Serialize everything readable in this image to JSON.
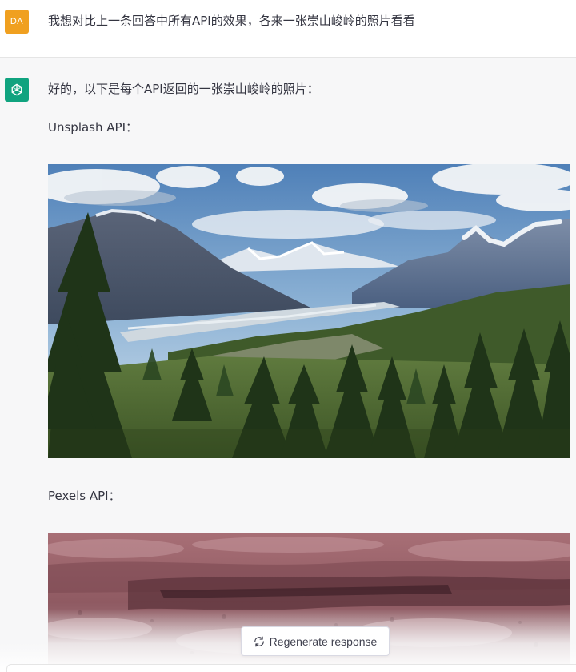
{
  "user_message": {
    "avatar_initials": "DA",
    "text": "我想对比上一条回答中所有API的效果，各来一张崇山峻岭的照片看看"
  },
  "assistant_message": {
    "intro": "好的，以下是每个API返回的一张崇山峻岭的照片：",
    "sections": [
      {
        "label": "Unsplash API：",
        "image": "mountain-lake-forest-photo"
      },
      {
        "label": "Pexels API：",
        "image": "red-rock-canyon-photo"
      }
    ]
  },
  "regenerate_button": {
    "label": "Regenerate response",
    "icon": "refresh-icon"
  },
  "colors": {
    "user_avatar": "#f0a020",
    "assistant_avatar": "#10a37f",
    "assistant_background": "#f7f7f8"
  }
}
